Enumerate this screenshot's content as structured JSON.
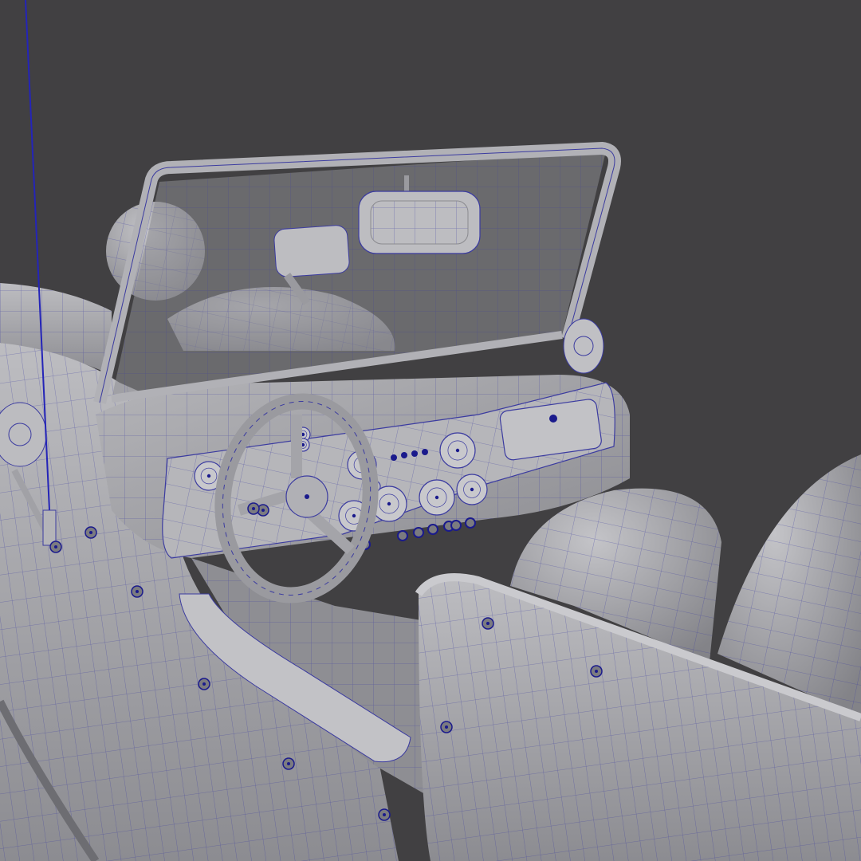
{
  "viewport": {
    "background_color": "#414042",
    "surface_color": "#a9a9ad",
    "surface_dark": "#7b7b80",
    "surface_light": "#c8c8cc",
    "wire_color": "#3b3ba0",
    "vertex_color": "#1a1a8c",
    "antenna_color": "#2424b8"
  },
  "scene": {
    "object": "car-interior-wireframe",
    "shading": "solid-with-wireframe-overlay",
    "gauge_count": 10,
    "indicator_dot_count": 4,
    "bolt_count": 11
  }
}
